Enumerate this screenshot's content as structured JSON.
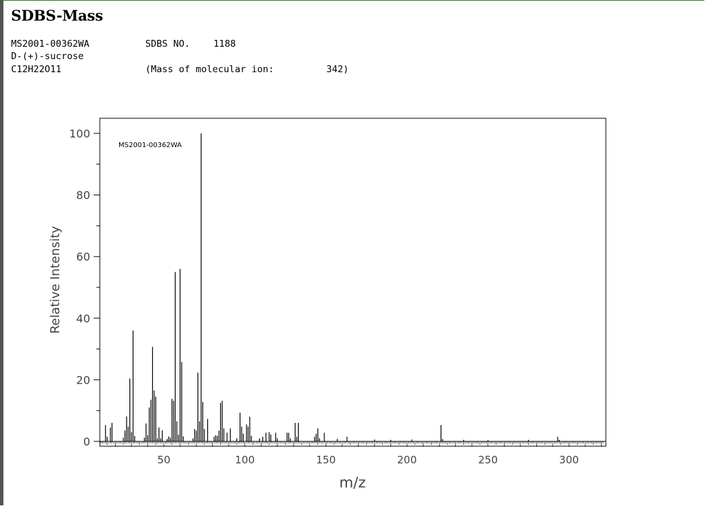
{
  "page": {
    "title": "SDBS-Mass"
  },
  "meta": {
    "id": "MS2001-00362WA",
    "sdbs_no_label": "SDBS NO.",
    "sdbs_no": "1188",
    "compound": "D-(+)-sucrose",
    "formula": "C12H22O11",
    "molecular_ion_label": "(Mass of molecular ion:",
    "molecular_ion": "342)"
  },
  "chart_data": {
    "type": "bar",
    "title": "",
    "inset_label": "MS2001-00362WA",
    "xlabel": "m/z",
    "ylabel": "Relative Intensity",
    "xlim": [
      10,
      321
    ],
    "ylim": [
      0,
      100
    ],
    "x_ticks": [
      50,
      100,
      150,
      200,
      250,
      300
    ],
    "y_ticks": [
      0,
      20,
      40,
      60,
      80,
      100
    ],
    "grid": false,
    "peaks": [
      {
        "mz": 14,
        "intensity": 5.3
      },
      {
        "mz": 15,
        "intensity": 1.5
      },
      {
        "mz": 17,
        "intensity": 4.5
      },
      {
        "mz": 18,
        "intensity": 6.0
      },
      {
        "mz": 25,
        "intensity": 1.2
      },
      {
        "mz": 26,
        "intensity": 3.5
      },
      {
        "mz": 27,
        "intensity": 8.1
      },
      {
        "mz": 28,
        "intensity": 4.8
      },
      {
        "mz": 29,
        "intensity": 20.4
      },
      {
        "mz": 30,
        "intensity": 3.0
      },
      {
        "mz": 31,
        "intensity": 36.0
      },
      {
        "mz": 32,
        "intensity": 1.8
      },
      {
        "mz": 38,
        "intensity": 1.2
      },
      {
        "mz": 39,
        "intensity": 5.8
      },
      {
        "mz": 40,
        "intensity": 2.0
      },
      {
        "mz": 41,
        "intensity": 11.0
      },
      {
        "mz": 42,
        "intensity": 13.5
      },
      {
        "mz": 43,
        "intensity": 30.7
      },
      {
        "mz": 44,
        "intensity": 16.5
      },
      {
        "mz": 45,
        "intensity": 14.5
      },
      {
        "mz": 46,
        "intensity": 1.0
      },
      {
        "mz": 47,
        "intensity": 4.5
      },
      {
        "mz": 48,
        "intensity": 1.0
      },
      {
        "mz": 49,
        "intensity": 3.6
      },
      {
        "mz": 52,
        "intensity": 0.8
      },
      {
        "mz": 53,
        "intensity": 1.6
      },
      {
        "mz": 54,
        "intensity": 1.2
      },
      {
        "mz": 55,
        "intensity": 13.8
      },
      {
        "mz": 56,
        "intensity": 13.2
      },
      {
        "mz": 57,
        "intensity": 55.0
      },
      {
        "mz": 58,
        "intensity": 6.5
      },
      {
        "mz": 59,
        "intensity": 2.2
      },
      {
        "mz": 60,
        "intensity": 56.0
      },
      {
        "mz": 61,
        "intensity": 25.8
      },
      {
        "mz": 62,
        "intensity": 1.6
      },
      {
        "mz": 68,
        "intensity": 1.0
      },
      {
        "mz": 69,
        "intensity": 4.0
      },
      {
        "mz": 70,
        "intensity": 3.5
      },
      {
        "mz": 71,
        "intensity": 22.3
      },
      {
        "mz": 72,
        "intensity": 6.5
      },
      {
        "mz": 73,
        "intensity": 100.0
      },
      {
        "mz": 74,
        "intensity": 12.8
      },
      {
        "mz": 75,
        "intensity": 4.0
      },
      {
        "mz": 77,
        "intensity": 7.3
      },
      {
        "mz": 81,
        "intensity": 1.5
      },
      {
        "mz": 82,
        "intensity": 2.0
      },
      {
        "mz": 83,
        "intensity": 1.8
      },
      {
        "mz": 84,
        "intensity": 3.5
      },
      {
        "mz": 85,
        "intensity": 12.5
      },
      {
        "mz": 86,
        "intensity": 13.2
      },
      {
        "mz": 87,
        "intensity": 4.2
      },
      {
        "mz": 89,
        "intensity": 2.8
      },
      {
        "mz": 91,
        "intensity": 4.2
      },
      {
        "mz": 95,
        "intensity": 1.0
      },
      {
        "mz": 97,
        "intensity": 9.3
      },
      {
        "mz": 98,
        "intensity": 4.8
      },
      {
        "mz": 99,
        "intensity": 2.5
      },
      {
        "mz": 101,
        "intensity": 5.5
      },
      {
        "mz": 102,
        "intensity": 4.8
      },
      {
        "mz": 103,
        "intensity": 8.0
      },
      {
        "mz": 104,
        "intensity": 1.8
      },
      {
        "mz": 109,
        "intensity": 1.0
      },
      {
        "mz": 111,
        "intensity": 1.5
      },
      {
        "mz": 113,
        "intensity": 2.8
      },
      {
        "mz": 115,
        "intensity": 3.0
      },
      {
        "mz": 116,
        "intensity": 2.2
      },
      {
        "mz": 119,
        "intensity": 2.8
      },
      {
        "mz": 120,
        "intensity": 1.0
      },
      {
        "mz": 126,
        "intensity": 2.8
      },
      {
        "mz": 127,
        "intensity": 2.8
      },
      {
        "mz": 128,
        "intensity": 1.0
      },
      {
        "mz": 131,
        "intensity": 6.0
      },
      {
        "mz": 132,
        "intensity": 1.5
      },
      {
        "mz": 133,
        "intensity": 6.0
      },
      {
        "mz": 143,
        "intensity": 1.5
      },
      {
        "mz": 144,
        "intensity": 2.5
      },
      {
        "mz": 145,
        "intensity": 4.2
      },
      {
        "mz": 146,
        "intensity": 1.0
      },
      {
        "mz": 149,
        "intensity": 2.8
      },
      {
        "mz": 157,
        "intensity": 0.8
      },
      {
        "mz": 163,
        "intensity": 1.5
      },
      {
        "mz": 180,
        "intensity": 0.6
      },
      {
        "mz": 190,
        "intensity": 0.5
      },
      {
        "mz": 203,
        "intensity": 0.6
      },
      {
        "mz": 221,
        "intensity": 5.3
      },
      {
        "mz": 222,
        "intensity": 0.8
      },
      {
        "mz": 235,
        "intensity": 0.5
      },
      {
        "mz": 250,
        "intensity": 0.4
      },
      {
        "mz": 275,
        "intensity": 0.5
      },
      {
        "mz": 293,
        "intensity": 1.5
      },
      {
        "mz": 294,
        "intensity": 0.5
      }
    ]
  }
}
